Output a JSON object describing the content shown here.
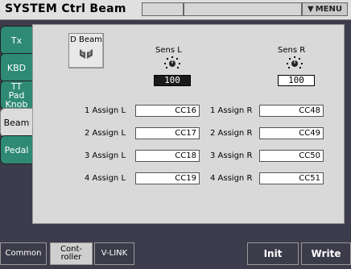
{
  "header": {
    "title": "SYSTEM Ctrl Beam",
    "menu_label": "MENU"
  },
  "tabs": [
    {
      "label": "Tx",
      "active": false
    },
    {
      "label": "KBD",
      "active": false
    },
    {
      "label": "TT Pad Knob",
      "active": false
    },
    {
      "label": "Beam",
      "active": true
    },
    {
      "label": "Pedal",
      "active": false
    }
  ],
  "dbeam": {
    "label": "D Beam",
    "icon": "dbeam-icon"
  },
  "sens": {
    "left": {
      "label": "Sens L",
      "value": "100"
    },
    "right": {
      "label": "Sens R",
      "value": "100"
    }
  },
  "assigns": [
    {
      "left_label": "1 Assign L",
      "left_value": "CC16",
      "right_label": "1 Assign R",
      "right_value": "CC48"
    },
    {
      "left_label": "2 Assign L",
      "left_value": "CC17",
      "right_label": "2 Assign R",
      "right_value": "CC49"
    },
    {
      "left_label": "3 Assign L",
      "left_value": "CC18",
      "right_label": "3 Assign R",
      "right_value": "CC50"
    },
    {
      "left_label": "4 Assign L",
      "left_value": "CC19",
      "right_label": "4 Assign R",
      "right_value": "CC51"
    }
  ],
  "bottom": {
    "common": "Common",
    "controller": "Cont-\nroller",
    "vlink": "V-LINK",
    "init": "Init",
    "write": "Write"
  },
  "colors": {
    "tab": "#2e8a74",
    "panel": "#d9d9d9",
    "background": "#3c3c4c"
  }
}
